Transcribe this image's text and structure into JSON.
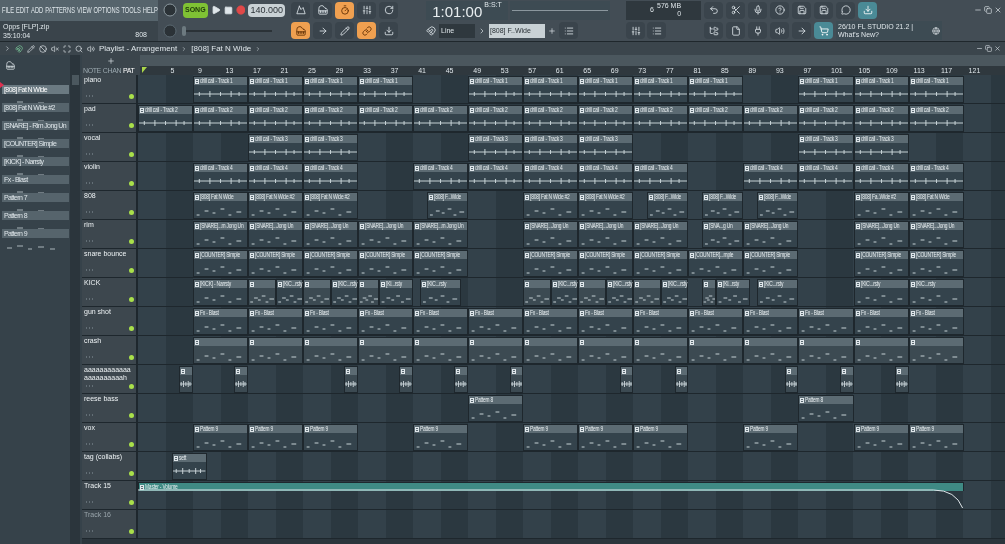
{
  "menu": [
    "FILE",
    "EDIT",
    "ADD",
    "PATTERNS",
    "VIEW",
    "OPTIONS",
    "TOOLS",
    "HELP"
  ],
  "project": {
    "name": "Opps [FLP].zip",
    "time": "35:10:04",
    "channel": "808"
  },
  "transport": {
    "mode": "SONG",
    "tempo": "140.000",
    "position": "1:01:00",
    "position_unit": "B:S:T"
  },
  "pitch": {
    "level": 0
  },
  "monitor": {
    "cpu": "6",
    "memory": "576 MB",
    "polyphony": "0"
  },
  "snap": "Line",
  "pattern_selector": "[808] F..Wide",
  "news": {
    "line1": "26/10  FL STUDIO 21.2 |",
    "line2": "What's New?"
  },
  "playlist": {
    "title": "Playlist - Arrangement",
    "pattern": "[808] Fat N Wide"
  },
  "picker_tabs": [
    "NOTE",
    "CHAN",
    "PAT"
  ],
  "patterns": [
    {
      "name": "[808] Fat N Wide",
      "selected": true
    },
    {
      "name": "[808] Fat N Wide #2",
      "selected": false
    },
    {
      "name": "[SNARE] - Rim Jong Un",
      "selected": false
    },
    {
      "name": "[COUNTER] Simple",
      "selected": false
    },
    {
      "name": "[KICK] - Narrsty",
      "selected": false
    },
    {
      "name": "Fx - Blast",
      "selected": false
    },
    {
      "name": "Pattern 7",
      "selected": false
    },
    {
      "name": "Pattern 8",
      "selected": false
    },
    {
      "name": "Pattern 9",
      "selected": false
    }
  ],
  "ruler": [
    "5",
    "9",
    "13",
    "17",
    "21",
    "25",
    "29",
    "33",
    "37",
    "41",
    "45",
    "49",
    "53",
    "57",
    "61",
    "65",
    "69",
    "73",
    "77",
    "81",
    "85",
    "89",
    "93",
    "97",
    "101",
    "105",
    "109",
    "113",
    "117",
    "121"
  ],
  "tracks": [
    {
      "name": "piano",
      "on": true,
      "disabled": false,
      "kind": "audio",
      "clips": [
        "drill call - Track 1",
        "drill call - Track 1",
        "drill call - Track 1",
        "drill call - Track 1",
        "drill call - Track 1",
        "drill call - Track 1",
        "drill call - Track 1",
        "drill call - Track 1",
        "drill call - Track 1",
        "drill call - Track 1",
        "drill call - Track 1",
        "drill call - Track 1"
      ]
    },
    {
      "name": "pad",
      "on": true,
      "disabled": false,
      "kind": "audio",
      "clips": [
        "drill call - Track 2",
        "drill call - Track 2",
        "drill call - Track 2",
        "drill call - Track 2",
        "drill call - Track 2",
        "drill call - Track 2",
        "drill call - Track 2",
        "drill call - Track 2",
        "drill call - Track 2",
        "drill call - Track 2",
        "drill call - Track 2",
        "drill call - Track 2",
        "drill call - Track 2",
        "drill call - Track 2",
        "drill call - Track 2"
      ]
    },
    {
      "name": "vocal",
      "on": true,
      "disabled": false,
      "kind": "audio",
      "clips": [
        "drill call - Track 3",
        "drill call - Track 3",
        "drill call - Track 3",
        "drill call - Track 3",
        "drill call - Track 3",
        "drill call - Track 3",
        "drill call - Track 3"
      ]
    },
    {
      "name": "violin",
      "on": true,
      "disabled": false,
      "kind": "audio",
      "clips": [
        "drill call - Track 4",
        "drill call - Track 4",
        "drill call - Track 4",
        "drill call - Track 4",
        "drill call - Track 4",
        "drill call - Track 4",
        "drill call - Track 4",
        "drill call - Track 4",
        "drill call - Track 4",
        "drill call - Track 4",
        "drill call - Track 4",
        "drill call - Track 4"
      ]
    },
    {
      "name": "808",
      "on": true,
      "disabled": false,
      "kind": "pattern",
      "clips": [
        "[808] Fat N Wide",
        "[808] Fat N Wide #2",
        "[808] Fat N Wide #2",
        "[808] F...Wide",
        "[808] Fat N Wide #2",
        "[808] Fat N Wide #2",
        "[808] F...Wide",
        "[808] F...Wide",
        "[808] F...Wide",
        "[808] Fa..Wide #2",
        "[808] Fat N Wide"
      ]
    },
    {
      "name": "rim",
      "on": true,
      "disabled": false,
      "kind": "pattern",
      "clips": [
        "[SNARE]...m Jong Un",
        "[SNARE]...Jong Un",
        "[SNARE]...Jong Un",
        "[SNARE]...Jong Un",
        "[SNARE]...m Jong Un",
        "[SNARE]...Jong Un",
        "[SNARE]...Jong Un",
        "[SNARE]...Jong Un",
        "[SNA...g Un",
        "[SNARE]...Jong Un",
        "[SNARE]...Jong Un",
        "[SNARE]...Jong Un"
      ]
    },
    {
      "name": "snare bounce",
      "on": true,
      "disabled": false,
      "kind": "pattern",
      "clips": [
        "[COUNTER] Simple",
        "[COUNTER] Simple",
        "[COUNTER] Simple",
        "[COUNTER] Simple",
        "[COUNTER] Simple",
        "[COUNTER] Simple",
        "[COUNTER] Simple",
        "[COUNTER] Simple",
        "[COUNTER]...mple",
        "[COUNTER] Simple",
        "[COUNTER] Simple",
        "[COUNTER] Simple"
      ]
    },
    {
      "name": "KICK",
      "on": true,
      "disabled": false,
      "kind": "pattern",
      "clips": [
        "[KICK] - Narrsty",
        "[KIC...rsty",
        "[KIC...rsty",
        "[KI...rsty",
        "[KIC...rsty",
        "[KIC...rsty",
        "[KIC...rsty",
        "[KIC...rsty",
        "[KI...rsty",
        "[KIC...rsty",
        "[KIC...rsty",
        "[KIC...rsty"
      ]
    },
    {
      "name": "gun shot",
      "on": true,
      "disabled": false,
      "kind": "pattern",
      "clips": [
        "Fx - Blast",
        "Fx - Blast",
        "Fx - Blast",
        "Fx - Blast",
        "Fx - Blast",
        "Fx - Blast",
        "Fx - Blast",
        "Fx - Blast",
        "Fx - Blast",
        "Fx - Blast",
        "Fx - Blast",
        "Fx - Blast",
        "Fx - Blast",
        "Fx - Blast"
      ]
    },
    {
      "name": "crash",
      "on": true,
      "disabled": false,
      "kind": "pattern"
    },
    {
      "name": "aaaaaaaaaaaaaaaaaaaaaah",
      "on": true,
      "disabled": false,
      "kind": "audio"
    },
    {
      "name": "reese bass",
      "on": true,
      "disabled": false,
      "kind": "pattern",
      "clips": [
        "Pattern 8",
        "Pattern 8"
      ]
    },
    {
      "name": "vox",
      "on": true,
      "disabled": false,
      "kind": "pattern",
      "clips": [
        "Pattern 9",
        "Pattern 9",
        "Pattern 9",
        "Pattern 9",
        "Pattern 9",
        "Pattern 9",
        "Pattern 9",
        "Pattern 9",
        "Pattern 9",
        "Pattern 9"
      ]
    },
    {
      "name": "tag (collabs)",
      "on": true,
      "disabled": false,
      "kind": "audio",
      "clips": [
        "sett"
      ]
    },
    {
      "name": "Track 15",
      "on": true,
      "disabled": false,
      "kind": "automation",
      "clips": [
        "Master - Volume"
      ]
    },
    {
      "name": "Track 16",
      "on": true,
      "disabled": true,
      "kind": "audio"
    }
  ]
}
